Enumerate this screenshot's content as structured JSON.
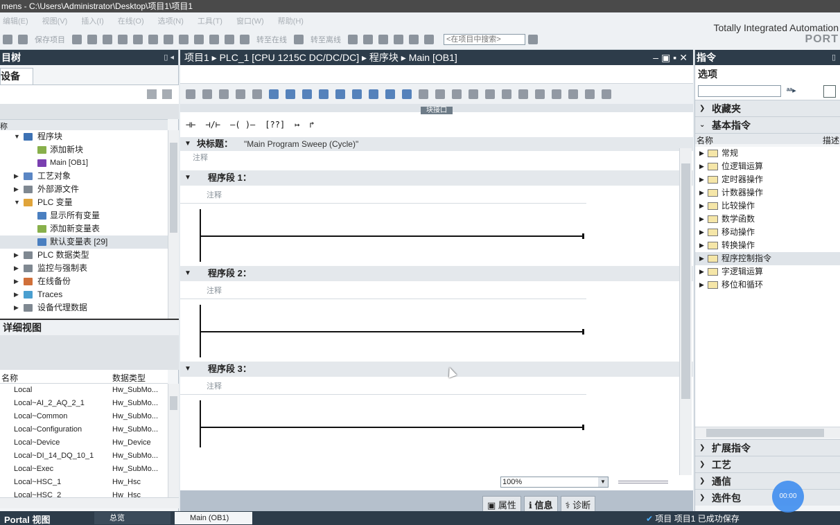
{
  "window": {
    "title": "mens  -  C:\\Users\\Administrator\\Desktop\\项目1\\项目1"
  },
  "menu": [
    "编辑(E)",
    "视图(V)",
    "插入(I)",
    "在线(O)",
    "选项(N)",
    "工具(T)",
    "窗口(W)",
    "帮助(H)"
  ],
  "toolbar": {
    "save_project": "保存项目",
    "go_online": "转至在线",
    "go_offline": "转至离线",
    "search_placeholder": "<在项目中搜索>"
  },
  "brand": {
    "line1": "Totally Integrated Automation",
    "line2": "PORT"
  },
  "project_tree": {
    "title": "目树",
    "device_tab": "设备",
    "column": "称",
    "items": [
      {
        "label": "程序块",
        "level": 1,
        "expanded": true
      },
      {
        "label": "添加新块",
        "level": 2
      },
      {
        "label": "Main [OB1]",
        "level": 2
      },
      {
        "label": "工艺对象",
        "level": 1,
        "expanded": false
      },
      {
        "label": "外部源文件",
        "level": 1,
        "expanded": false
      },
      {
        "label": "PLC 变量",
        "level": 1,
        "expanded": true
      },
      {
        "label": "显示所有变量",
        "level": 2
      },
      {
        "label": "添加新变量表",
        "level": 2
      },
      {
        "label": "默认变量表 [29]",
        "level": 2,
        "selected": true
      },
      {
        "label": "PLC 数据类型",
        "level": 1,
        "expanded": false
      },
      {
        "label": "监控与强制表",
        "level": 1,
        "expanded": false
      },
      {
        "label": "在线备份",
        "level": 1,
        "expanded": false
      },
      {
        "label": "Traces",
        "level": 1,
        "expanded": false
      },
      {
        "label": "设备代理数据",
        "level": 1,
        "expanded": false
      }
    ]
  },
  "detail_view": {
    "title": "详细视图",
    "col_name": "名称",
    "col_type": "数据类型",
    "rows": [
      {
        "name": "Local",
        "type": "Hw_SubMo..."
      },
      {
        "name": "Local~AI_2_AQ_2_1",
        "type": "Hw_SubMo..."
      },
      {
        "name": "Local~Common",
        "type": "Hw_SubMo..."
      },
      {
        "name": "Local~Configuration",
        "type": "Hw_SubMo..."
      },
      {
        "name": "Local~Device",
        "type": "Hw_Device"
      },
      {
        "name": "Local~DI_14_DQ_10_1",
        "type": "Hw_SubMo..."
      },
      {
        "name": "Local~Exec",
        "type": "Hw_SubMo..."
      },
      {
        "name": "Local~HSC_1",
        "type": "Hw_Hsc"
      },
      {
        "name": "Local~HSC_2",
        "type": "Hw_Hsc"
      }
    ]
  },
  "editor": {
    "breadcrumb": "项目1 ▸ PLC_1 [CPU 1215C DC/DC/DC] ▸ 程序块 ▸ Main [OB1]",
    "interface": "块接口",
    "ladder_tools": [
      "⊣⊢",
      "⊣/⊢",
      "–( )–",
      "[??]",
      "↦",
      "↱"
    ],
    "block_title_label": "块标题：",
    "block_title_value": "\"Main Program Sweep (Cycle)\"",
    "comment": "注释",
    "networks": [
      {
        "label": "程序段 1：",
        "comment": "注释"
      },
      {
        "label": "程序段 2：",
        "comment": "注释"
      },
      {
        "label": "程序段 3：",
        "comment": "注释"
      }
    ],
    "zoom": "100%",
    "bottom_tabs": [
      "属性",
      "信息",
      "诊断"
    ]
  },
  "instructions": {
    "title": "指令",
    "options": "选项",
    "favorites": "收藏夹",
    "basic": "基本指令",
    "col_name": "名称",
    "col_desc": "描述",
    "items": [
      {
        "label": "常规"
      },
      {
        "label": "位逻辑运算"
      },
      {
        "label": "定时器操作"
      },
      {
        "label": "计数器操作"
      },
      {
        "label": "比较操作"
      },
      {
        "label": "数学函数"
      },
      {
        "label": "移动操作"
      },
      {
        "label": "转换操作"
      },
      {
        "label": "程序控制指令",
        "selected": true
      },
      {
        "label": "字逻辑运算"
      },
      {
        "label": "移位和循环"
      }
    ],
    "extended": "扩展指令",
    "technology": "工艺",
    "communication": "通信",
    "optional": "选件包"
  },
  "taskbar": {
    "portal": "Portal 视图",
    "overview": "总览",
    "main_tab": "Main (OB1)",
    "status": "项目 项目1 已成功保存"
  },
  "float": {
    "label": "00:00"
  }
}
